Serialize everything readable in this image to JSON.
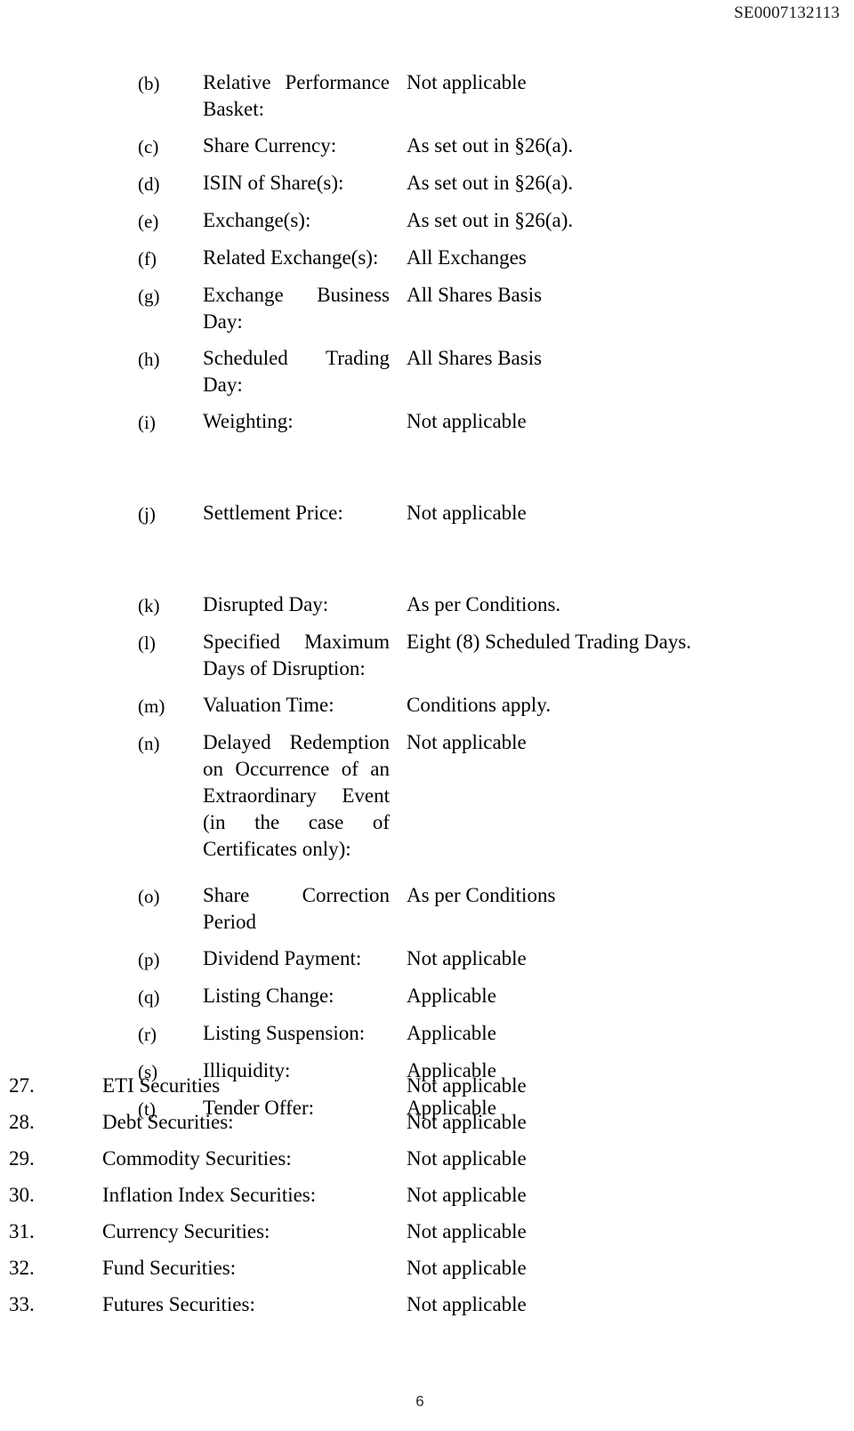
{
  "document": {
    "header_reference": "SE0007132113",
    "page_number": "6"
  },
  "lettered_items": [
    {
      "marker": "(b)",
      "label": "Relative Performance Basket:",
      "value": "Not applicable",
      "justified": true
    },
    {
      "marker": "(c)",
      "label": "Share Currency:",
      "value": "As set out in §26(a).",
      "justified": false
    },
    {
      "marker": "(d)",
      "label": "ISIN of Share(s):",
      "value": "As set out in §26(a).",
      "justified": false
    },
    {
      "marker": "(e)",
      "label": "Exchange(s):",
      "value": "As set out in §26(a).",
      "justified": false
    },
    {
      "marker": "(f)",
      "label": "Related Exchange(s):",
      "value": "All Exchanges",
      "justified": false
    },
    {
      "marker": "(g)",
      "label": "Exchange Business Day:",
      "value": "All Shares Basis",
      "justified": true
    },
    {
      "marker": "(h)",
      "label": "Scheduled Trading Day:",
      "value": "All Shares Basis",
      "justified": true
    },
    {
      "marker": "(i)",
      "label": "Weighting:",
      "value": "Not applicable",
      "justified": false
    },
    {
      "marker": "(j)",
      "label": "Settlement Price:",
      "value": "Not applicable",
      "justified": false
    },
    {
      "marker": "(k)",
      "label": "Disrupted Day:",
      "value": "As per Conditions.",
      "justified": false
    },
    {
      "marker": "(l)",
      "label": "Specified Maximum Days of Disruption:",
      "value": "Eight (8) Scheduled Trading Days.",
      "justified": true
    },
    {
      "marker": "(m)",
      "label": "Valuation Time:",
      "value": "Conditions apply.",
      "justified": false
    },
    {
      "marker": "(n)",
      "label": "Delayed Redemption on Occurrence of an Extraordinary Event (in the case of Certificates only):",
      "value": "Not applicable",
      "justified": true
    },
    {
      "marker": "(o)",
      "label": "Share Correction Period",
      "value": "As per Conditions",
      "justified": true
    },
    {
      "marker": "(p)",
      "label": "Dividend Payment:",
      "value": "Not applicable",
      "justified": false
    },
    {
      "marker": "(q)",
      "label": "Listing Change:",
      "value": "Applicable",
      "justified": false
    },
    {
      "marker": "(r)",
      "label": "Listing Suspension:",
      "value": "Applicable",
      "justified": false
    },
    {
      "marker": "(s)",
      "label": "Illiquidity:",
      "value": "Applicable",
      "justified": false
    },
    {
      "marker": "(t)",
      "label": "Tender Offer:",
      "value": "Applicable",
      "justified": false
    }
  ],
  "numbered_items": [
    {
      "marker": "27.",
      "label": "ETI Securities",
      "value": "Not applicable"
    },
    {
      "marker": "28.",
      "label": "Debt Securities:",
      "value": "Not applicable"
    },
    {
      "marker": "29.",
      "label": "Commodity Securities:",
      "value": "Not applicable"
    },
    {
      "marker": "30.",
      "label": "Inflation Index Securities:",
      "value": "Not applicable"
    },
    {
      "marker": "31.",
      "label": "Currency Securities:",
      "value": "Not applicable"
    },
    {
      "marker": "32.",
      "label": "Fund Securities:",
      "value": "Not applicable"
    },
    {
      "marker": "33.",
      "label": "Futures Securities:",
      "value": "Not applicable"
    }
  ]
}
